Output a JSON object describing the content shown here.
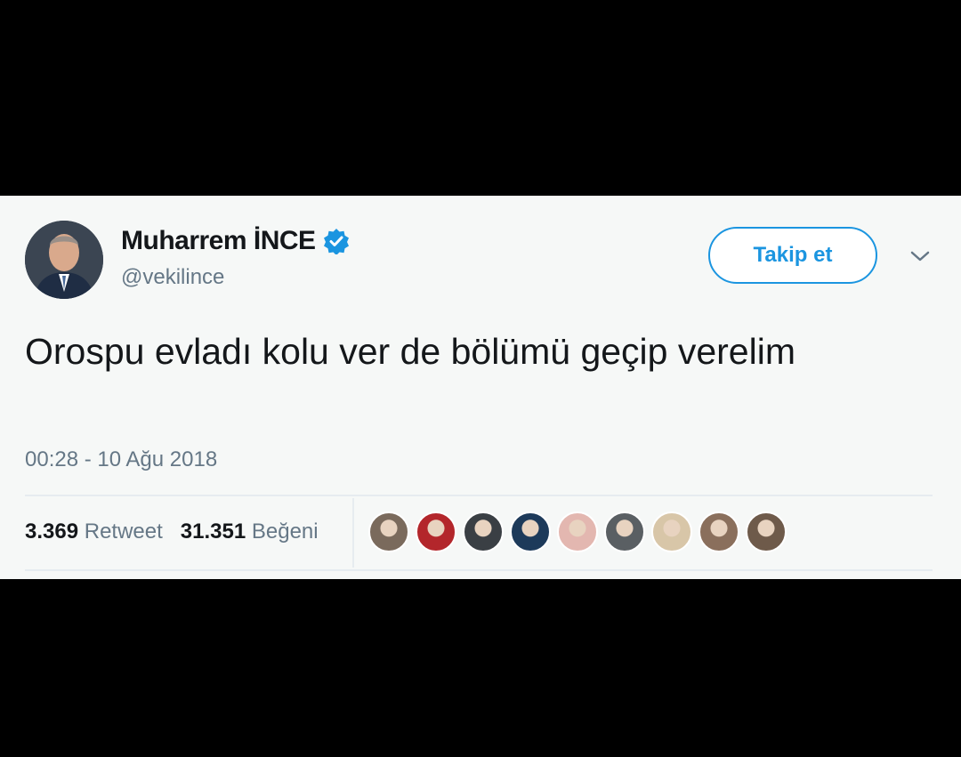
{
  "tweet": {
    "display_name": "Muharrem İNCE",
    "handle": "@vekilince",
    "follow_label": "Takip et",
    "text": "Orospu evladı kolu ver de bölümü geçip verelim",
    "timestamp": "00:28 - 10 Ağu 2018",
    "retweet_count": "3.369",
    "retweet_label": "Retweet",
    "like_count": "31.351",
    "like_label": "Beğeni"
  },
  "icons": {
    "verified": "verified-badge-icon",
    "menu": "chevron-down-icon"
  },
  "colors": {
    "accent": "#1b95e0",
    "background": "#f6f8f7",
    "text": "#14171a",
    "muted": "#657786"
  },
  "liker_avatars": [
    {
      "color": "#7a6a5c"
    },
    {
      "color": "#b3262b"
    },
    {
      "color": "#3a3f44"
    },
    {
      "color": "#1d3a5a"
    },
    {
      "color": "#e3b7b0"
    },
    {
      "color": "#5a5f63"
    },
    {
      "color": "#d8c6a8"
    },
    {
      "color": "#8a6f5c"
    },
    {
      "color": "#6e5a4a"
    }
  ]
}
